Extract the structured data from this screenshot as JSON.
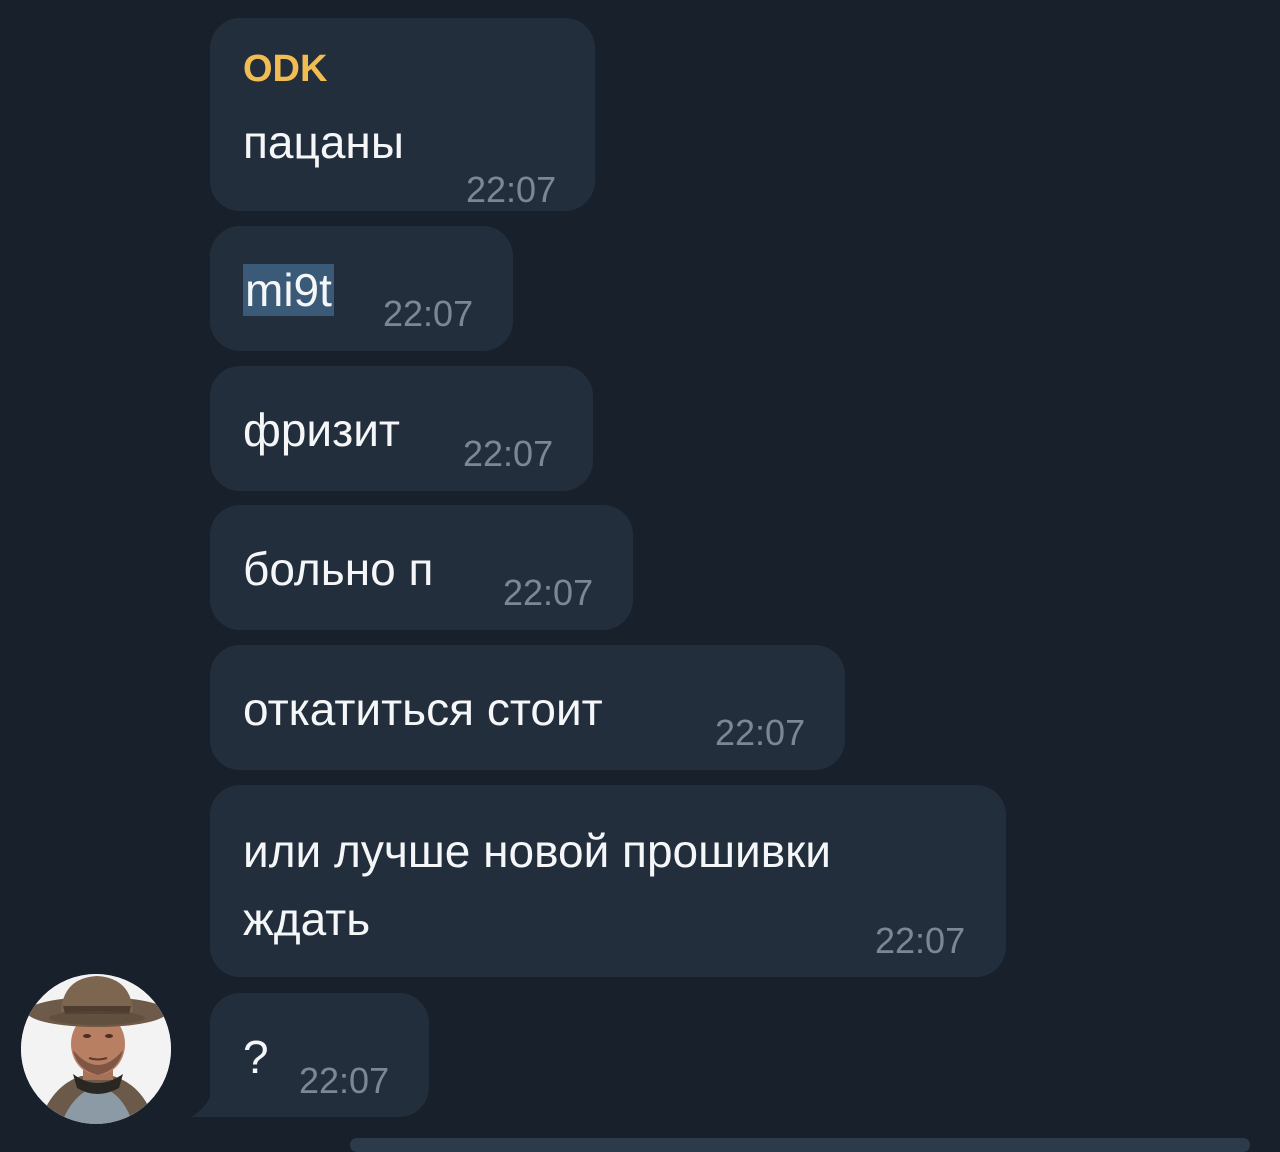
{
  "messages": [
    {
      "sender": "ODK",
      "text": "пацаны",
      "time": "22:07"
    },
    {
      "text": "mi9t",
      "time": "22:07"
    },
    {
      "text": "фризит",
      "time": "22:07"
    },
    {
      "text": "больно п",
      "time": "22:07"
    },
    {
      "text": "откатиться стоит",
      "time": "22:07"
    },
    {
      "text_line1": "или лучше новой прошивки",
      "text_line2": "ждать",
      "time": "22:07"
    },
    {
      "text": "?",
      "time": "22:07"
    }
  ],
  "avatar": {
    "icon": "cowboy-avatar-icon"
  },
  "colors": {
    "background": "#17202b",
    "bubble": "#232e3c",
    "sender_name": "#f1bd53",
    "time": "#7a8896",
    "selection": "#3a5a78"
  }
}
